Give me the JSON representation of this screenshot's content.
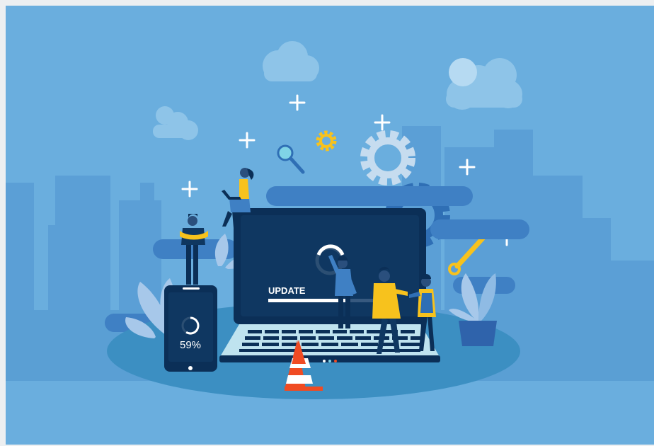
{
  "scene": {
    "laptop_label": "UPDATE",
    "update_progress": 0.72,
    "phone_label": "59%",
    "phone_progress": 0.59
  },
  "colors": {
    "sky": "#6aaede",
    "skyline": "#5b9fd6",
    "ground_band": "#5a9fd4",
    "floor_ellipse": "#3c8fc2",
    "laptop_body": "#0b2f57",
    "laptop_screen": "#0f3761",
    "keyboard_base": "#bfe3ef",
    "accent_yellow": "#f7c21d",
    "gear_light": "#c6dcef",
    "gear_dark": "#2f6fb5",
    "cone": "#f04b23"
  },
  "icons": [
    "cloud-icon",
    "sparkle-icon",
    "gear-icon",
    "magnifier-icon",
    "wrench-icon",
    "traffic-cone-icon",
    "plant-icon",
    "spinner-icon"
  ]
}
